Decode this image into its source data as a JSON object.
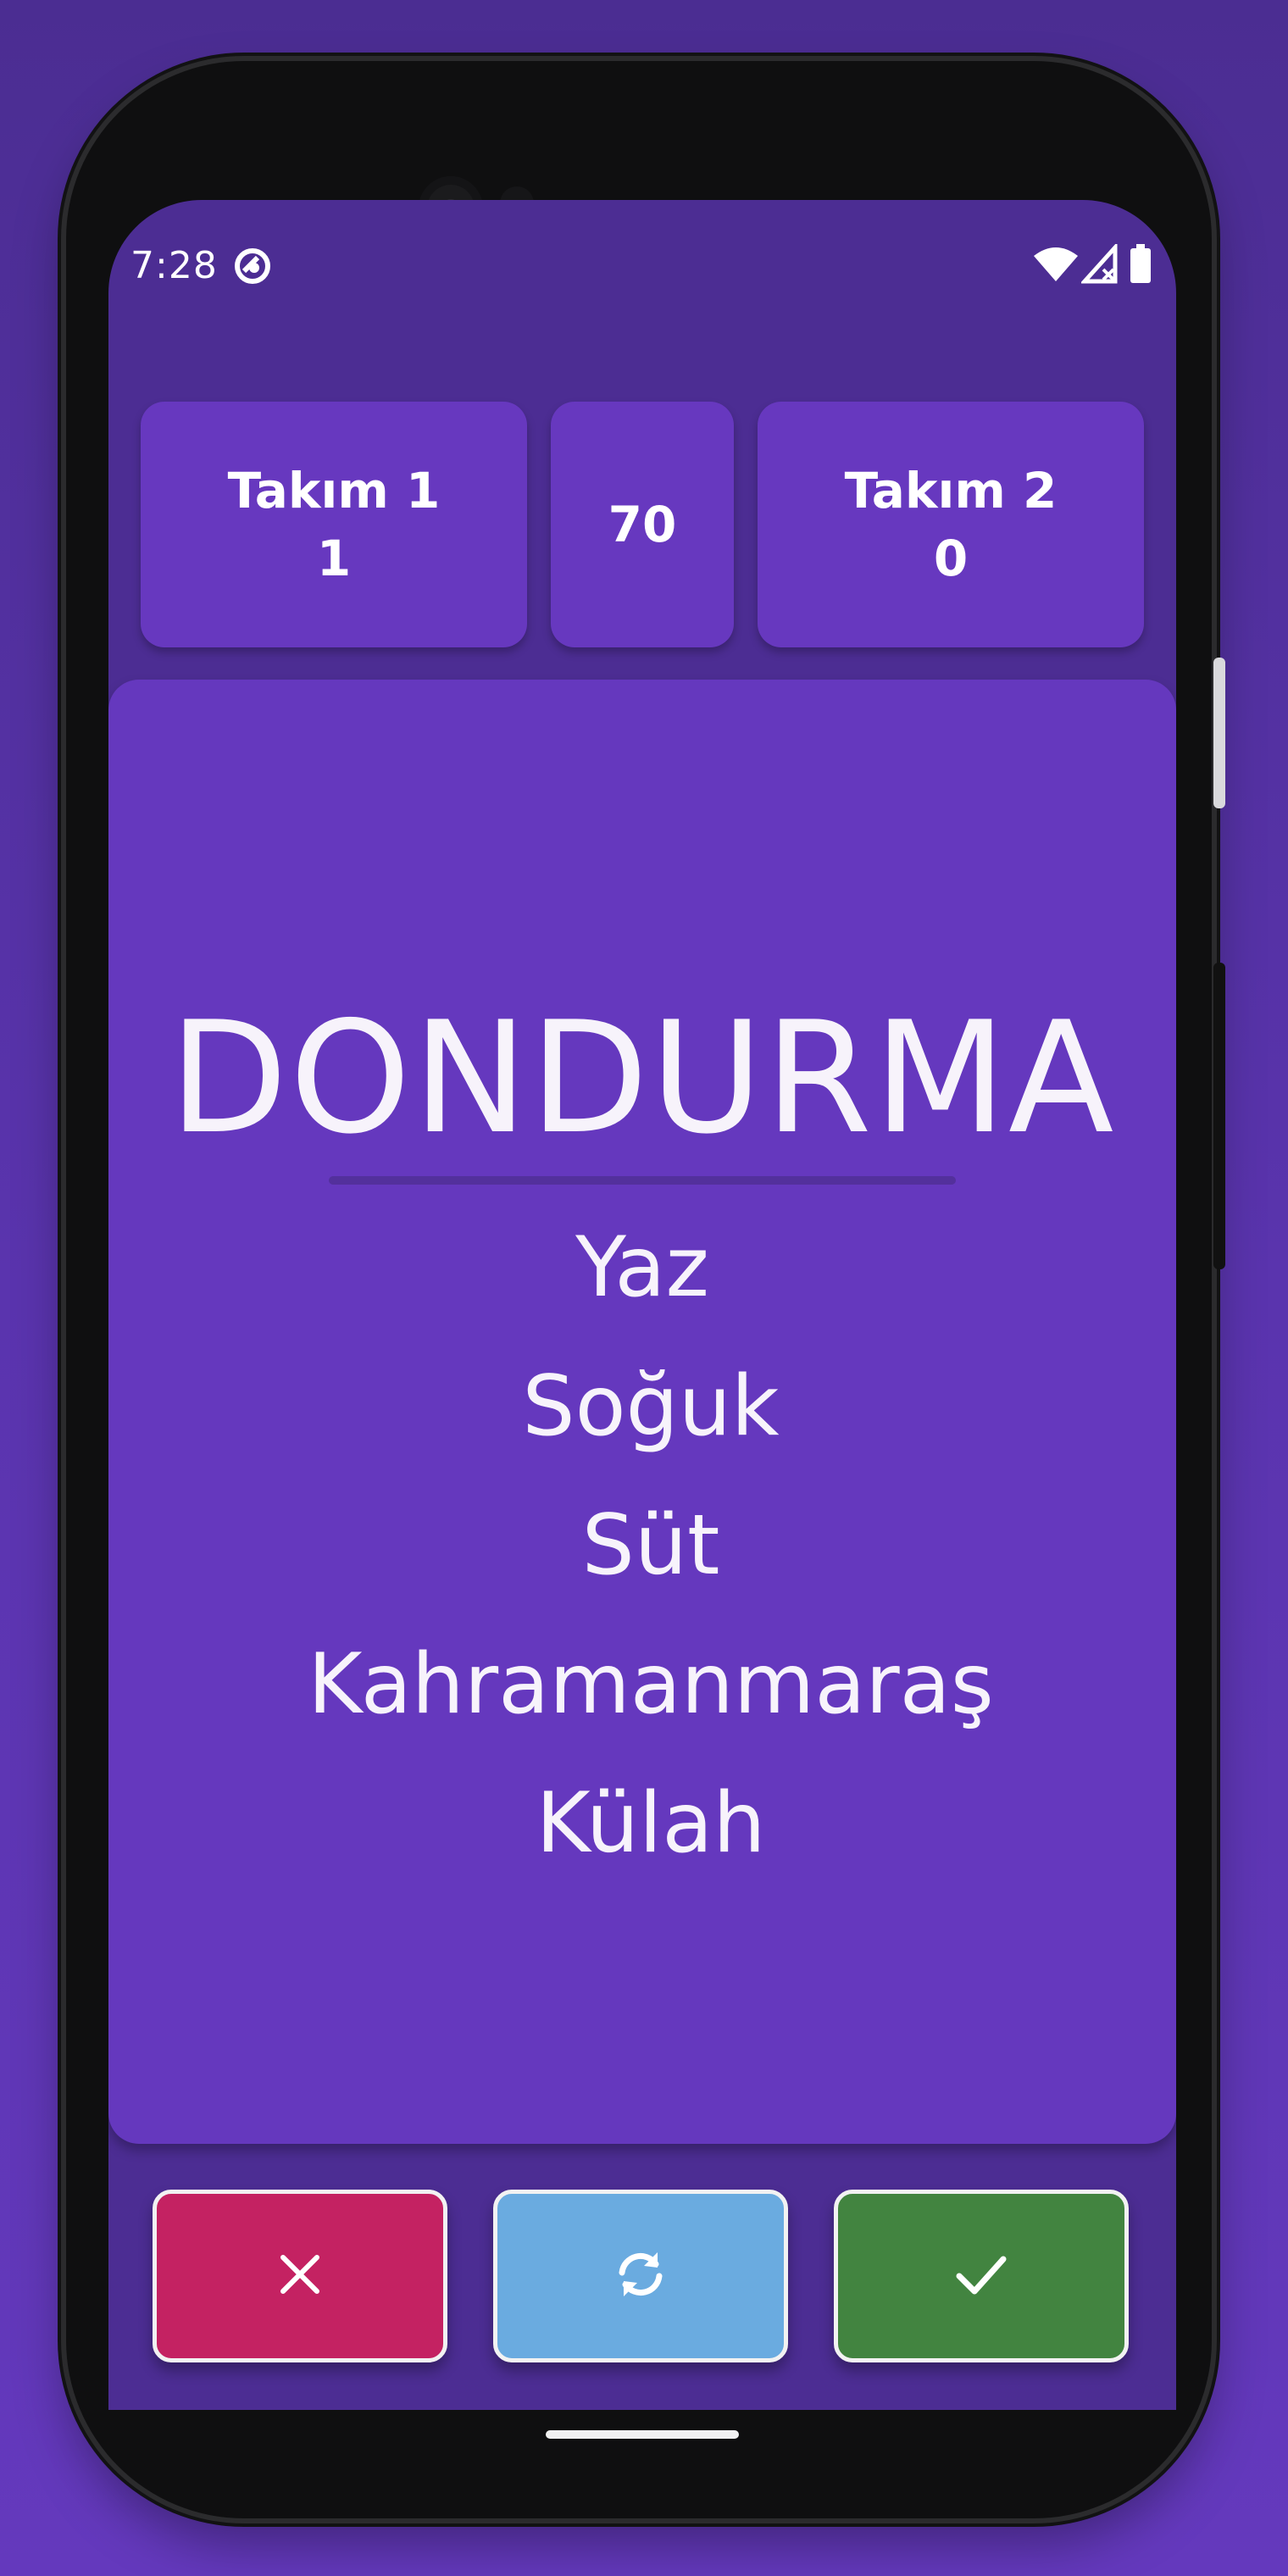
{
  "status_bar": {
    "time": "7:28"
  },
  "scoreboard": {
    "team1": {
      "name": "Takım 1",
      "score": "1"
    },
    "timer": "70",
    "team2": {
      "name": "Takım 2",
      "score": "0"
    }
  },
  "card": {
    "word": "DONDURMA",
    "taboo_words": [
      "Yaz",
      "Soğuk",
      "Süt",
      "Kahramanmaraş",
      "Külah"
    ]
  },
  "actions": {
    "wrong": {
      "icon": "close-icon",
      "color": "#c42262"
    },
    "pass": {
      "icon": "refresh-icon",
      "color": "#6aabe0"
    },
    "correct": {
      "icon": "check-icon",
      "color": "#428440"
    }
  },
  "colors": {
    "background": "#4b2d92",
    "card": "#6538be",
    "box": "#6738bf"
  }
}
